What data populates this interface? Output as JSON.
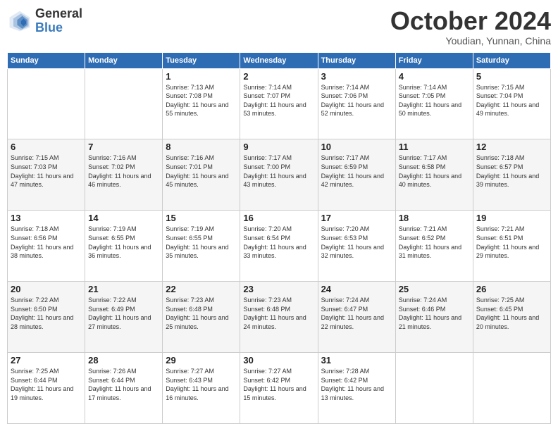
{
  "header": {
    "logo_general": "General",
    "logo_blue": "Blue",
    "month": "October 2024",
    "location": "Youdian, Yunnan, China"
  },
  "weekdays": [
    "Sunday",
    "Monday",
    "Tuesday",
    "Wednesday",
    "Thursday",
    "Friday",
    "Saturday"
  ],
  "weeks": [
    [
      {
        "day": "",
        "content": ""
      },
      {
        "day": "",
        "content": ""
      },
      {
        "day": "1",
        "content": "Sunrise: 7:13 AM\nSunset: 7:08 PM\nDaylight: 11 hours and 55 minutes."
      },
      {
        "day": "2",
        "content": "Sunrise: 7:14 AM\nSunset: 7:07 PM\nDaylight: 11 hours and 53 minutes."
      },
      {
        "day": "3",
        "content": "Sunrise: 7:14 AM\nSunset: 7:06 PM\nDaylight: 11 hours and 52 minutes."
      },
      {
        "day": "4",
        "content": "Sunrise: 7:14 AM\nSunset: 7:05 PM\nDaylight: 11 hours and 50 minutes."
      },
      {
        "day": "5",
        "content": "Sunrise: 7:15 AM\nSunset: 7:04 PM\nDaylight: 11 hours and 49 minutes."
      }
    ],
    [
      {
        "day": "6",
        "content": "Sunrise: 7:15 AM\nSunset: 7:03 PM\nDaylight: 11 hours and 47 minutes."
      },
      {
        "day": "7",
        "content": "Sunrise: 7:16 AM\nSunset: 7:02 PM\nDaylight: 11 hours and 46 minutes."
      },
      {
        "day": "8",
        "content": "Sunrise: 7:16 AM\nSunset: 7:01 PM\nDaylight: 11 hours and 45 minutes."
      },
      {
        "day": "9",
        "content": "Sunrise: 7:17 AM\nSunset: 7:00 PM\nDaylight: 11 hours and 43 minutes."
      },
      {
        "day": "10",
        "content": "Sunrise: 7:17 AM\nSunset: 6:59 PM\nDaylight: 11 hours and 42 minutes."
      },
      {
        "day": "11",
        "content": "Sunrise: 7:17 AM\nSunset: 6:58 PM\nDaylight: 11 hours and 40 minutes."
      },
      {
        "day": "12",
        "content": "Sunrise: 7:18 AM\nSunset: 6:57 PM\nDaylight: 11 hours and 39 minutes."
      }
    ],
    [
      {
        "day": "13",
        "content": "Sunrise: 7:18 AM\nSunset: 6:56 PM\nDaylight: 11 hours and 38 minutes."
      },
      {
        "day": "14",
        "content": "Sunrise: 7:19 AM\nSunset: 6:55 PM\nDaylight: 11 hours and 36 minutes."
      },
      {
        "day": "15",
        "content": "Sunrise: 7:19 AM\nSunset: 6:55 PM\nDaylight: 11 hours and 35 minutes."
      },
      {
        "day": "16",
        "content": "Sunrise: 7:20 AM\nSunset: 6:54 PM\nDaylight: 11 hours and 33 minutes."
      },
      {
        "day": "17",
        "content": "Sunrise: 7:20 AM\nSunset: 6:53 PM\nDaylight: 11 hours and 32 minutes."
      },
      {
        "day": "18",
        "content": "Sunrise: 7:21 AM\nSunset: 6:52 PM\nDaylight: 11 hours and 31 minutes."
      },
      {
        "day": "19",
        "content": "Sunrise: 7:21 AM\nSunset: 6:51 PM\nDaylight: 11 hours and 29 minutes."
      }
    ],
    [
      {
        "day": "20",
        "content": "Sunrise: 7:22 AM\nSunset: 6:50 PM\nDaylight: 11 hours and 28 minutes."
      },
      {
        "day": "21",
        "content": "Sunrise: 7:22 AM\nSunset: 6:49 PM\nDaylight: 11 hours and 27 minutes."
      },
      {
        "day": "22",
        "content": "Sunrise: 7:23 AM\nSunset: 6:48 PM\nDaylight: 11 hours and 25 minutes."
      },
      {
        "day": "23",
        "content": "Sunrise: 7:23 AM\nSunset: 6:48 PM\nDaylight: 11 hours and 24 minutes."
      },
      {
        "day": "24",
        "content": "Sunrise: 7:24 AM\nSunset: 6:47 PM\nDaylight: 11 hours and 22 minutes."
      },
      {
        "day": "25",
        "content": "Sunrise: 7:24 AM\nSunset: 6:46 PM\nDaylight: 11 hours and 21 minutes."
      },
      {
        "day": "26",
        "content": "Sunrise: 7:25 AM\nSunset: 6:45 PM\nDaylight: 11 hours and 20 minutes."
      }
    ],
    [
      {
        "day": "27",
        "content": "Sunrise: 7:25 AM\nSunset: 6:44 PM\nDaylight: 11 hours and 19 minutes."
      },
      {
        "day": "28",
        "content": "Sunrise: 7:26 AM\nSunset: 6:44 PM\nDaylight: 11 hours and 17 minutes."
      },
      {
        "day": "29",
        "content": "Sunrise: 7:27 AM\nSunset: 6:43 PM\nDaylight: 11 hours and 16 minutes."
      },
      {
        "day": "30",
        "content": "Sunrise: 7:27 AM\nSunset: 6:42 PM\nDaylight: 11 hours and 15 minutes."
      },
      {
        "day": "31",
        "content": "Sunrise: 7:28 AM\nSunset: 6:42 PM\nDaylight: 11 hours and 13 minutes."
      },
      {
        "day": "",
        "content": ""
      },
      {
        "day": "",
        "content": ""
      }
    ]
  ]
}
